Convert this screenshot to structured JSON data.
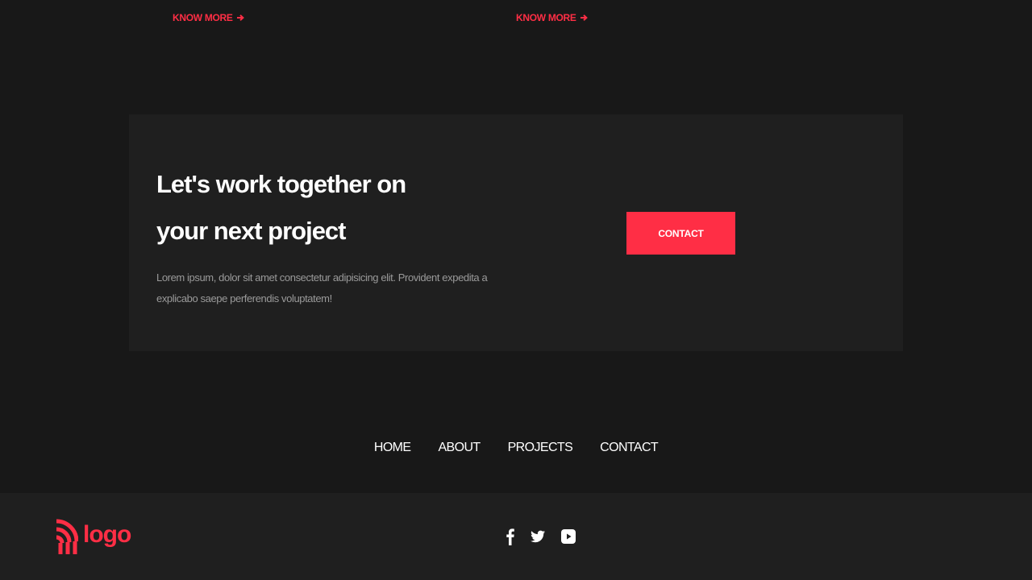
{
  "cards": {
    "link_1": "KNOW MORE",
    "link_2": "KNOW MORE"
  },
  "cta": {
    "title": "Let's work together on your next project",
    "text": "Lorem ipsum, dolor sit amet consectetur adipisicing elit. Provident expedita a explicabo saepe perferendis voluptatem!",
    "button_label": "CONTACT"
  },
  "footer_nav": {
    "items": [
      "HOME",
      "ABOUT",
      "PROJECTS",
      "CONTACT"
    ]
  },
  "footer": {
    "logo_text": "logo",
    "socials": [
      "facebook-icon",
      "twitter-icon",
      "youtube-icon"
    ]
  },
  "colors": {
    "background": "#181818",
    "panel": "#1f1f1f",
    "accent": "#ff2e45",
    "text": "#ffffff",
    "muted_text": "#9a9a9a"
  }
}
